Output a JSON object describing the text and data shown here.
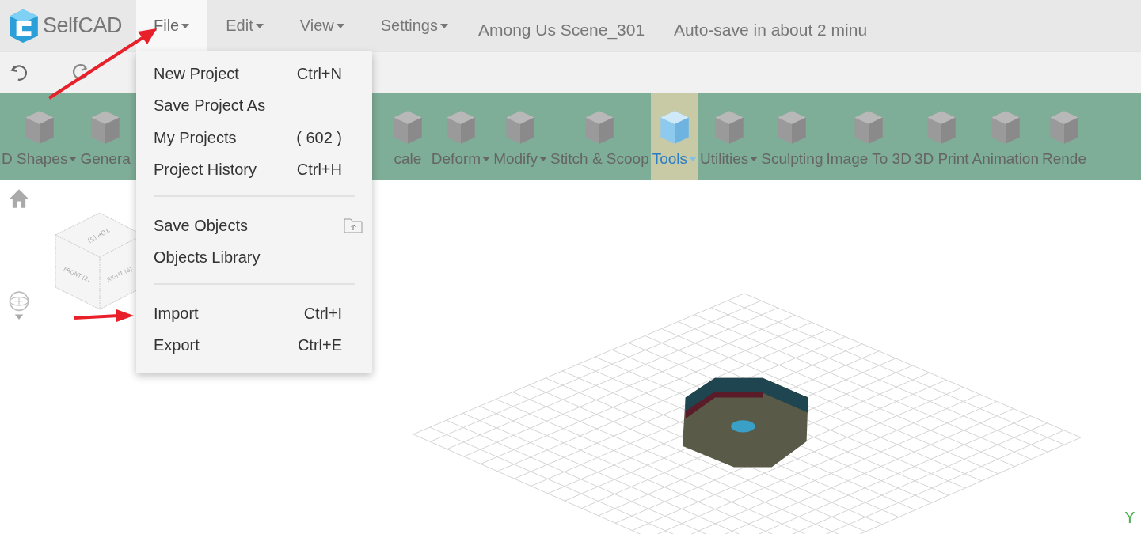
{
  "app": {
    "name": "SelfCAD"
  },
  "menu_bar": [
    {
      "label": "File",
      "selected": true,
      "caret": true
    },
    {
      "label": "Edit",
      "selected": false,
      "caret": true
    },
    {
      "label": "View",
      "selected": false,
      "caret": true
    },
    {
      "label": "Settings",
      "selected": false,
      "caret": true
    }
  ],
  "project_title": "Among Us Scene_301",
  "autosave_status": "Auto-save in about 2 minu",
  "toolbar": [
    {
      "label": "D Shapes",
      "caret": true,
      "selected": false
    },
    {
      "label": "Genera",
      "caret": false,
      "selected": false
    },
    {
      "label": "cale",
      "caret": false,
      "selected": false
    },
    {
      "label": "Deform",
      "caret": true,
      "selected": false
    },
    {
      "label": "Modify",
      "caret": true,
      "selected": false
    },
    {
      "label": "Stitch & Scoop",
      "caret": false,
      "selected": false
    },
    {
      "label": "Tools",
      "caret": true,
      "selected": true
    },
    {
      "label": "Utilities",
      "caret": true,
      "selected": false
    },
    {
      "label": "Sculpting",
      "caret": false,
      "selected": false
    },
    {
      "label": "Image To 3D",
      "caret": false,
      "selected": false
    },
    {
      "label": "3D Print",
      "caret": false,
      "selected": false
    },
    {
      "label": "Animation",
      "caret": false,
      "selected": false
    },
    {
      "label": "Rende",
      "caret": false,
      "selected": false
    }
  ],
  "file_menu": [
    [
      {
        "label": "New Project",
        "shortcut": "Ctrl+N"
      },
      {
        "label": "Save Project As"
      },
      {
        "label": "My Projects",
        "shortcut": "( 602 )"
      },
      {
        "label": "Project History",
        "shortcut": "Ctrl+H"
      }
    ],
    [
      {
        "label": "Save Objects"
      },
      {
        "label": "Objects Library"
      }
    ],
    [
      {
        "label": "Import",
        "shortcut": "Ctrl+I"
      },
      {
        "label": "Export",
        "shortcut": "Ctrl+E"
      }
    ]
  ],
  "view_cube": {
    "top": "TOP (5)",
    "front": "FRONT (2)",
    "right": "RIGHT (6)"
  },
  "axis_label": "Y"
}
